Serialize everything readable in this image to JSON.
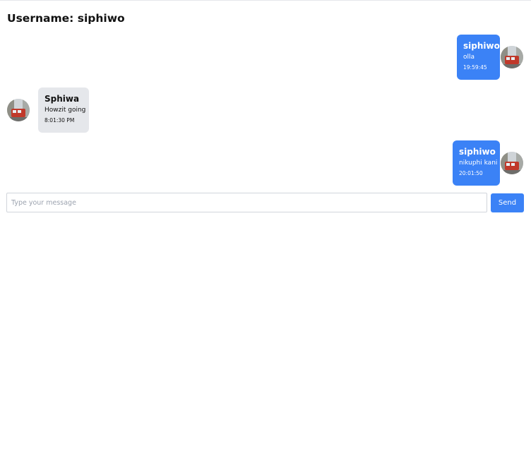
{
  "header": {
    "username_label": "Username: siphiwo"
  },
  "messages": [
    {
      "sender": "siphiwo",
      "text": "olla",
      "time": "19:59:45",
      "direction": "sent",
      "avatar_icon": "user-avatar-photo"
    },
    {
      "sender": "Sphiwa",
      "text": "Howzit going",
      "time": "8:01:30 PM",
      "direction": "received",
      "avatar_icon": "user-avatar-photo"
    },
    {
      "sender": "siphiwo",
      "text": "nikuphi kani",
      "time": "20:01:50",
      "direction": "sent",
      "avatar_icon": "user-avatar-photo"
    }
  ],
  "composer": {
    "placeholder": "Type your message",
    "value": "",
    "send_label": "Send"
  },
  "colors": {
    "sent_bubble": "#3b82f6",
    "received_bubble": "#e5e7eb",
    "send_button": "#3b82f6"
  }
}
